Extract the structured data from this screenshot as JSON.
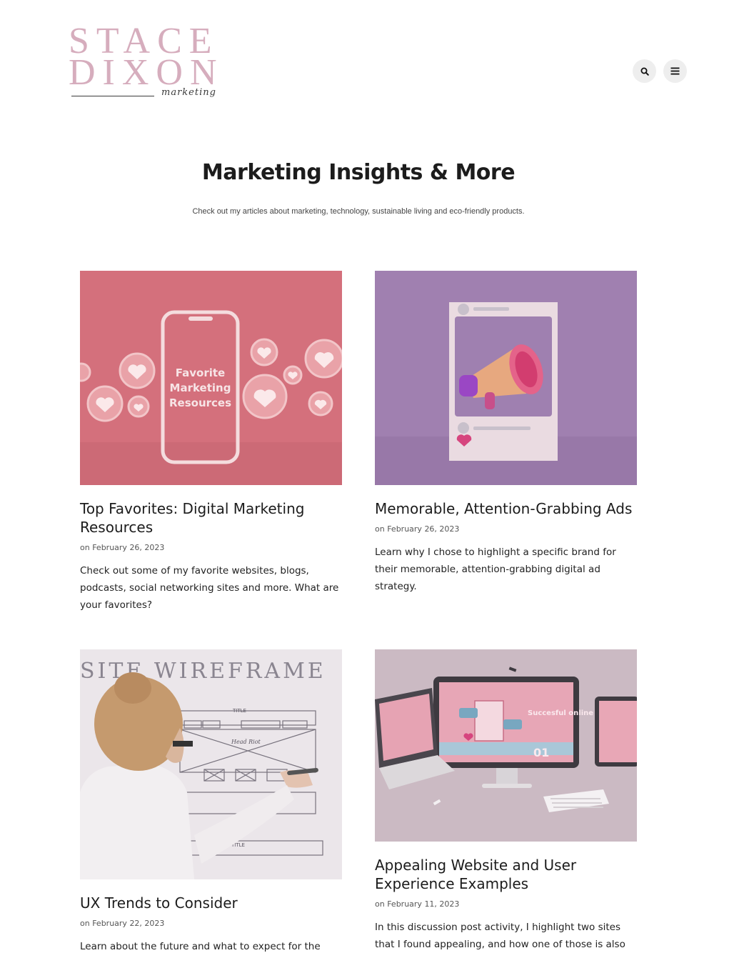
{
  "header": {
    "logo": {
      "line1": "STACE",
      "line2": "DIXON",
      "script": "marketing"
    },
    "search_icon": "search-icon",
    "menu_icon": "hamburger-menu-icon"
  },
  "hero": {
    "title": "Marketing Insights & More",
    "subtitle": "Check out my articles about marketing, technology, sustainable living and eco-friendly products."
  },
  "posts": [
    {
      "title": "Top Favorites: Digital Marketing Resources",
      "date": "on February 26, 2023",
      "excerpt": "Check out some of my favorite websites, blogs, podcasts, social networking sites and more. What are your favorites?",
      "image_text": [
        "Favorite",
        "Marketing",
        "Resources"
      ]
    },
    {
      "title": "Memorable, Attention-Grabbing Ads",
      "date": "on February 26, 2023",
      "excerpt": "Learn why I chose to highlight a specific brand for their memorable, attention-grabbing digital ad strategy."
    },
    {
      "title": "UX Trends to Consider",
      "date": "on February 22, 2023",
      "excerpt": "Learn about the future and what to expect for the state",
      "image_text": [
        "SITE WIREFRAME",
        "TITLE",
        "Head Riot",
        "TITLE"
      ]
    },
    {
      "title": "Appealing Website and User Experience Examples",
      "date": "on February 11, 2023",
      "excerpt": "In this discussion post activity, I highlight two sites that I found appealing, and how one of those is also",
      "image_text": [
        "Succesful online strategy.",
        "01"
      ]
    }
  ],
  "colors": {
    "logo_pink": "#d6adbd",
    "card1_bg": "#d4707c",
    "card2_bg": "#a080b0",
    "card4_bg": "#c9b6c0"
  }
}
